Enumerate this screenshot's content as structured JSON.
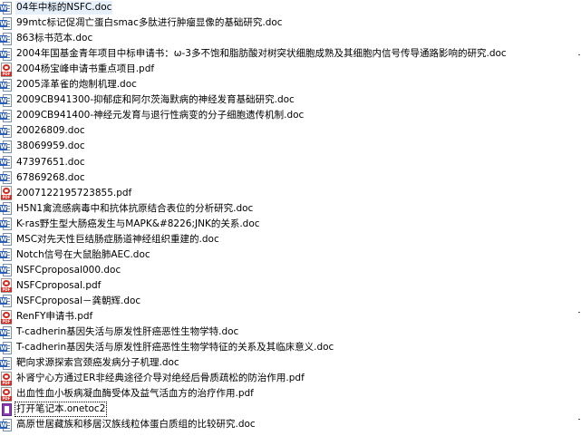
{
  "files": [
    {
      "name": "04年中标的NSFC.doc",
      "type": "doc"
    },
    {
      "name": "99mtc标记促凋亡蛋白smac多肽进行肿瘤显像的基础研究.doc",
      "type": "doc"
    },
    {
      "name": "863标书范本.doc",
      "type": "doc"
    },
    {
      "name": "2004年国基金青年项目中标申请书：ω-3多不饱和脂肪酸对树突状细胞成熟及其细胞内信号传导通路影响的研究.doc",
      "type": "doc"
    },
    {
      "name": "2004杨宝峰申请书重点项目.pdf",
      "type": "pdf"
    },
    {
      "name": "2005泽革雀的炮制机理.doc",
      "type": "doc"
    },
    {
      "name": "2009CB941300-抑郁症和阿尔茨海默病的神经发育基础研究.doc",
      "type": "doc"
    },
    {
      "name": "2009CB941400-神经元发育与退行性病变的分子细胞遗传机制.doc",
      "type": "doc"
    },
    {
      "name": "20026809.doc",
      "type": "doc"
    },
    {
      "name": "38069959.doc",
      "type": "doc"
    },
    {
      "name": "47397651.doc",
      "type": "doc"
    },
    {
      "name": "67869268.doc",
      "type": "doc"
    },
    {
      "name": "2007122195723855.pdf",
      "type": "pdf"
    },
    {
      "name": "H5N1禽流感病毒中和抗体抗原结合表位的分析研究.doc",
      "type": "doc"
    },
    {
      "name": "K-ras野生型大肠癌发生与MAPK&#8226;JNK的关系.doc",
      "type": "doc"
    },
    {
      "name": "MSC对先天性巨结肠症肠道神经组织重建的.doc",
      "type": "doc"
    },
    {
      "name": "Notch信号在大鼠胎肺AEC.doc",
      "type": "doc"
    },
    {
      "name": "NSFCproposal000.doc",
      "type": "doc"
    },
    {
      "name": "NSFCproposal.pdf",
      "type": "pdf"
    },
    {
      "name": "NSFCproposal－龚朝辉.doc",
      "type": "doc"
    },
    {
      "name": "RenFY申请书.pdf",
      "type": "pdf"
    },
    {
      "name": "T-cadherin基因失活与原发性肝癌恶性生物学特.doc",
      "type": "doc"
    },
    {
      "name": "T-cadherin基因失活与原发性肝癌恶性生物学特征的关系及其临床意义.doc",
      "type": "doc"
    },
    {
      "name": "靶向求源探索宫颈癌发病分子机理.doc",
      "type": "doc"
    },
    {
      "name": "补肾宁心方通过ER非经典途径介导对绝经后骨质疏松的防治作用.pdf",
      "type": "pdf"
    },
    {
      "name": "出血性血小板病凝血酶受体及益气活血方的治疗作用.pdf",
      "type": "pdf"
    },
    {
      "name": "打开笔记本.onetoc2",
      "type": "onetoc",
      "selected": true
    },
    {
      "name": "高原世居藏族和移居汉族线粒体蛋白质组的比较研究.doc",
      "type": "doc"
    }
  ],
  "icons": {
    "doc": "word-document-icon",
    "pdf": "pdf-document-icon",
    "onetoc": "onenote-notebook-icon"
  },
  "icon_badges": {
    "doc": "W",
    "pdf": "PDF"
  }
}
